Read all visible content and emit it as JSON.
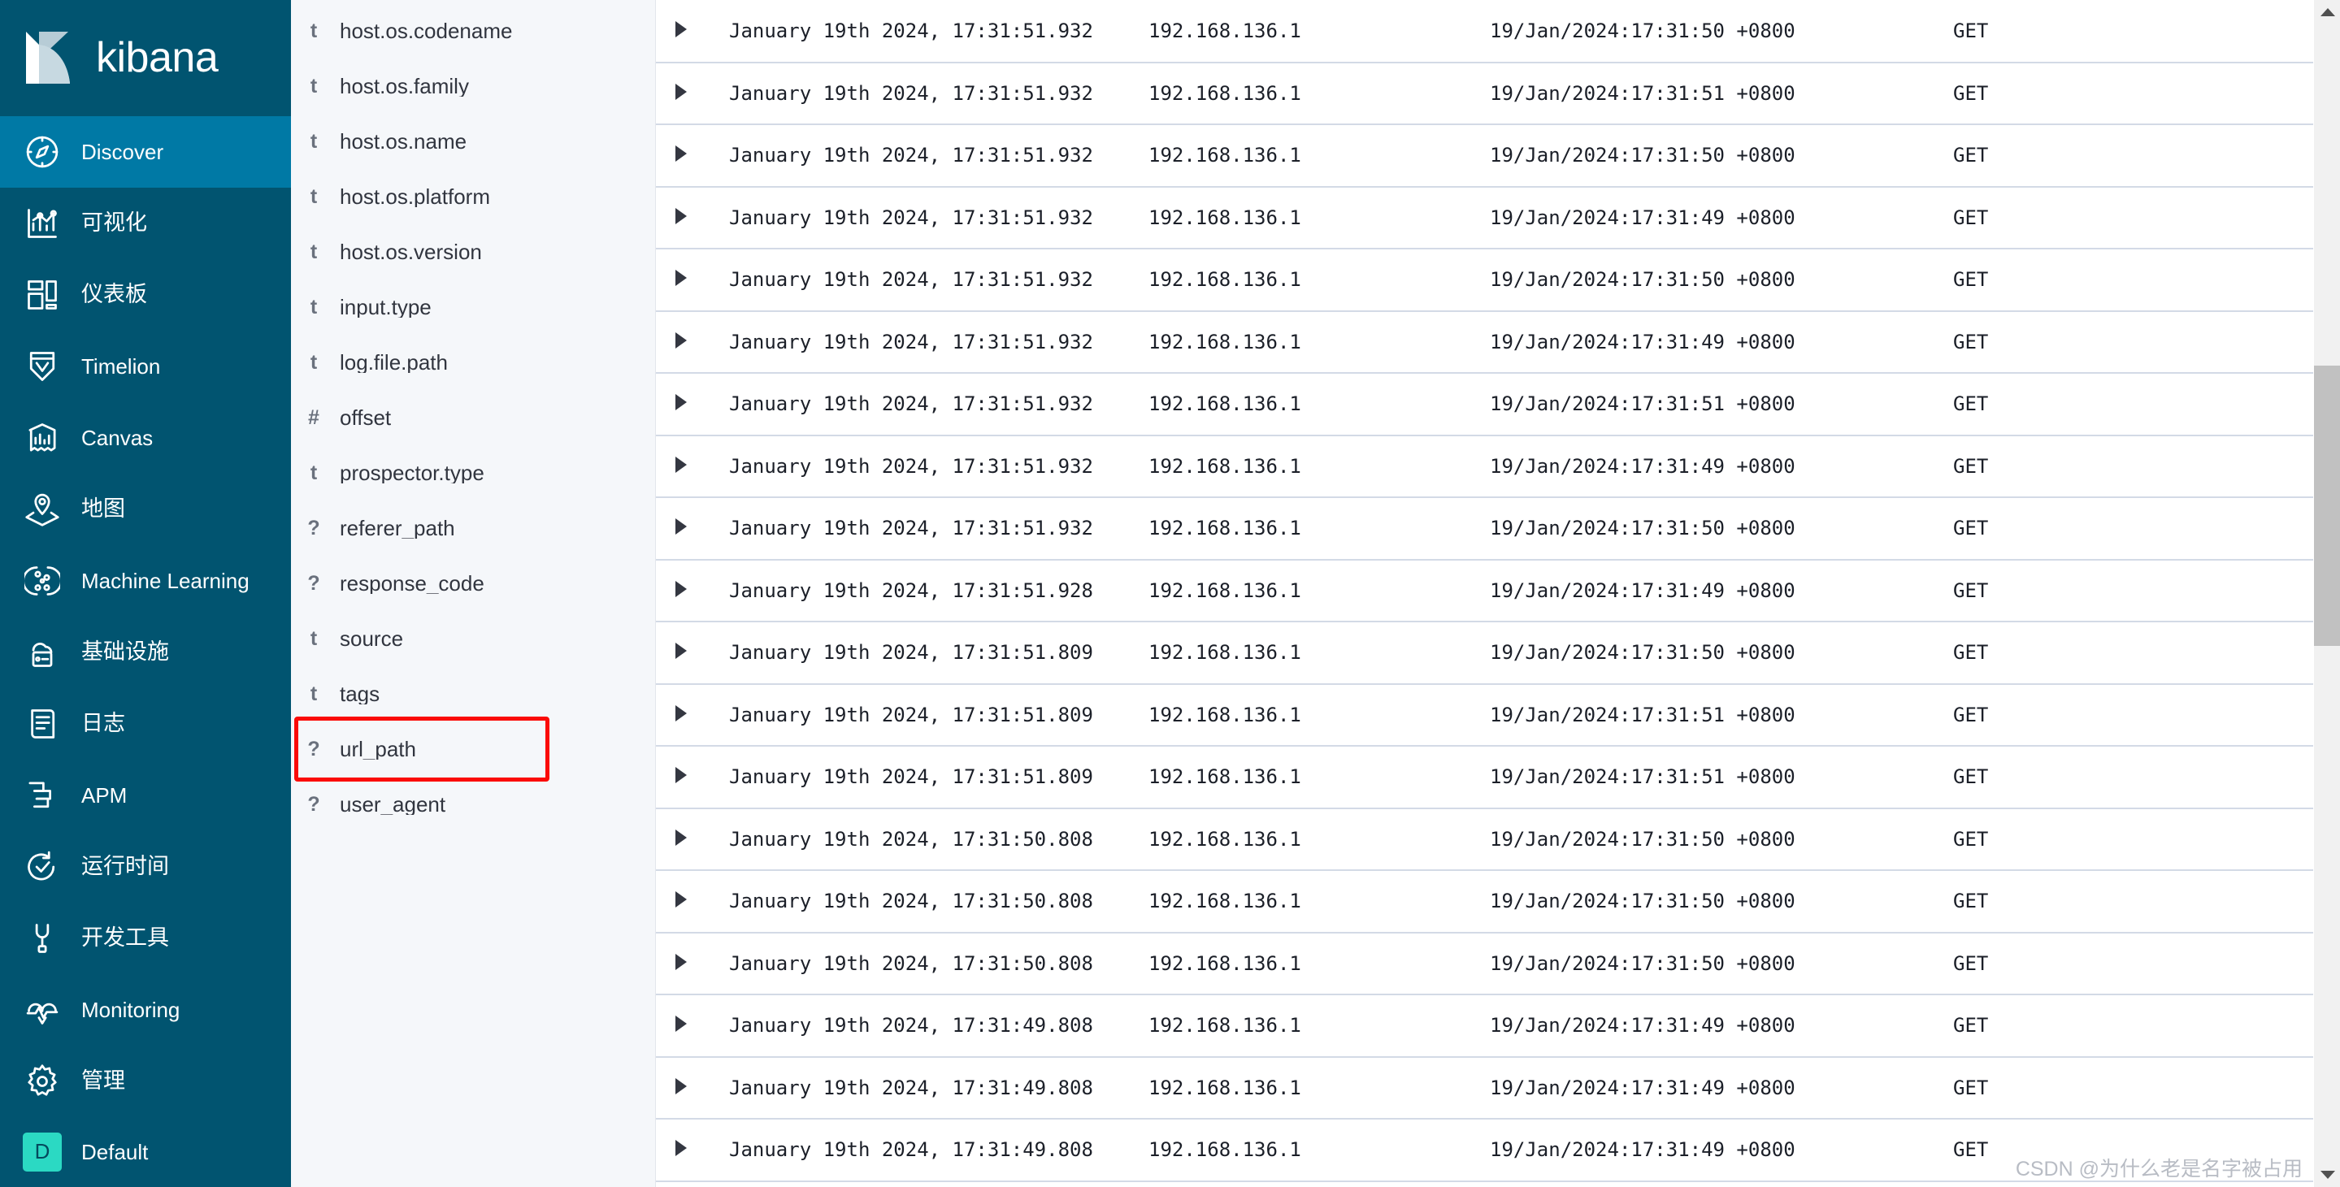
{
  "app": {
    "brand_name": "kibana",
    "logo_icon": "kibana-logo-icon"
  },
  "sidebar": {
    "items": [
      {
        "label": "Discover",
        "icon": "compass-icon",
        "active": true,
        "cjk": false
      },
      {
        "label": "可视化",
        "icon": "visualize-icon",
        "active": false,
        "cjk": true
      },
      {
        "label": "仪表板",
        "icon": "dashboard-icon",
        "active": false,
        "cjk": true
      },
      {
        "label": "Timelion",
        "icon": "timelion-icon",
        "active": false,
        "cjk": false
      },
      {
        "label": "Canvas",
        "icon": "canvas-icon",
        "active": false,
        "cjk": false
      },
      {
        "label": "地图",
        "icon": "maps-icon",
        "active": false,
        "cjk": true
      },
      {
        "label": "Machine Learning",
        "icon": "machine-learning-icon",
        "active": false,
        "cjk": false
      },
      {
        "label": "基础设施",
        "icon": "infrastructure-icon",
        "active": false,
        "cjk": true
      },
      {
        "label": "日志",
        "icon": "logs-icon",
        "active": false,
        "cjk": true
      },
      {
        "label": "APM",
        "icon": "apm-icon",
        "active": false,
        "cjk": false
      },
      {
        "label": "运行时间",
        "icon": "uptime-icon",
        "active": false,
        "cjk": true
      },
      {
        "label": "开发工具",
        "icon": "dev-tools-icon",
        "active": false,
        "cjk": true
      },
      {
        "label": "Monitoring",
        "icon": "monitoring-icon",
        "active": false,
        "cjk": false
      },
      {
        "label": "管理",
        "icon": "management-icon",
        "active": false,
        "cjk": true
      }
    ],
    "user": {
      "initial": "D",
      "label": "Default"
    }
  },
  "field_panel": {
    "fields": [
      {
        "type": "t",
        "name": "host.os.codename",
        "highlight": false
      },
      {
        "type": "t",
        "name": "host.os.family",
        "highlight": false
      },
      {
        "type": "t",
        "name": "host.os.name",
        "highlight": false
      },
      {
        "type": "t",
        "name": "host.os.platform",
        "highlight": false
      },
      {
        "type": "t",
        "name": "host.os.version",
        "highlight": false
      },
      {
        "type": "t",
        "name": "input.type",
        "highlight": false
      },
      {
        "type": "t",
        "name": "log.file.path",
        "highlight": false
      },
      {
        "type": "#",
        "name": "offset",
        "highlight": false
      },
      {
        "type": "t",
        "name": "prospector.type",
        "highlight": false
      },
      {
        "type": "?",
        "name": "referer_path",
        "highlight": false
      },
      {
        "type": "?",
        "name": "response_code",
        "highlight": false
      },
      {
        "type": "t",
        "name": "source",
        "highlight": false
      },
      {
        "type": "t",
        "name": "tags",
        "highlight": false
      },
      {
        "type": "?",
        "name": "url_path",
        "highlight": true
      },
      {
        "type": "?",
        "name": "user_agent",
        "highlight": false
      }
    ]
  },
  "main": {
    "expand_icon": "expand-row-caret-icon",
    "rows": [
      {
        "time": "January 19th 2024, 17:31:51.932",
        "ip": "192.168.136.1",
        "ts": "19/Jan/2024:17:31:50 +0800",
        "method": "GET"
      },
      {
        "time": "January 19th 2024, 17:31:51.932",
        "ip": "192.168.136.1",
        "ts": "19/Jan/2024:17:31:51 +0800",
        "method": "GET"
      },
      {
        "time": "January 19th 2024, 17:31:51.932",
        "ip": "192.168.136.1",
        "ts": "19/Jan/2024:17:31:50 +0800",
        "method": "GET"
      },
      {
        "time": "January 19th 2024, 17:31:51.932",
        "ip": "192.168.136.1",
        "ts": "19/Jan/2024:17:31:49 +0800",
        "method": "GET"
      },
      {
        "time": "January 19th 2024, 17:31:51.932",
        "ip": "192.168.136.1",
        "ts": "19/Jan/2024:17:31:50 +0800",
        "method": "GET"
      },
      {
        "time": "January 19th 2024, 17:31:51.932",
        "ip": "192.168.136.1",
        "ts": "19/Jan/2024:17:31:49 +0800",
        "method": "GET"
      },
      {
        "time": "January 19th 2024, 17:31:51.932",
        "ip": "192.168.136.1",
        "ts": "19/Jan/2024:17:31:51 +0800",
        "method": "GET"
      },
      {
        "time": "January 19th 2024, 17:31:51.932",
        "ip": "192.168.136.1",
        "ts": "19/Jan/2024:17:31:49 +0800",
        "method": "GET"
      },
      {
        "time": "January 19th 2024, 17:31:51.932",
        "ip": "192.168.136.1",
        "ts": "19/Jan/2024:17:31:50 +0800",
        "method": "GET"
      },
      {
        "time": "January 19th 2024, 17:31:51.928",
        "ip": "192.168.136.1",
        "ts": "19/Jan/2024:17:31:49 +0800",
        "method": "GET"
      },
      {
        "time": "January 19th 2024, 17:31:51.809",
        "ip": "192.168.136.1",
        "ts": "19/Jan/2024:17:31:50 +0800",
        "method": "GET"
      },
      {
        "time": "January 19th 2024, 17:31:51.809",
        "ip": "192.168.136.1",
        "ts": "19/Jan/2024:17:31:51 +0800",
        "method": "GET"
      },
      {
        "time": "January 19th 2024, 17:31:51.809",
        "ip": "192.168.136.1",
        "ts": "19/Jan/2024:17:31:51 +0800",
        "method": "GET"
      },
      {
        "time": "January 19th 2024, 17:31:50.808",
        "ip": "192.168.136.1",
        "ts": "19/Jan/2024:17:31:50 +0800",
        "method": "GET"
      },
      {
        "time": "January 19th 2024, 17:31:50.808",
        "ip": "192.168.136.1",
        "ts": "19/Jan/2024:17:31:50 +0800",
        "method": "GET"
      },
      {
        "time": "January 19th 2024, 17:31:50.808",
        "ip": "192.168.136.1",
        "ts": "19/Jan/2024:17:31:50 +0800",
        "method": "GET"
      },
      {
        "time": "January 19th 2024, 17:31:49.808",
        "ip": "192.168.136.1",
        "ts": "19/Jan/2024:17:31:49 +0800",
        "method": "GET"
      },
      {
        "time": "January 19th 2024, 17:31:49.808",
        "ip": "192.168.136.1",
        "ts": "19/Jan/2024:17:31:49 +0800",
        "method": "GET"
      },
      {
        "time": "January 19th 2024, 17:31:49.808",
        "ip": "192.168.136.1",
        "ts": "19/Jan/2024:17:31:49 +0800",
        "method": "GET"
      }
    ]
  },
  "scrollbar": {
    "up_icon": "scroll-up-arrow-icon",
    "down_icon": "scroll-down-arrow-icon"
  },
  "watermark": {
    "text": "CSDN @为什么老是名字被占用"
  },
  "colors": {
    "sidebar_bg": "#015470",
    "sidebar_active": "#0079a5",
    "avatar_bg": "#2bd9c3",
    "field_panel_bg": "#f5f7fa",
    "highlight_border": "#fb0b07",
    "row_border": "#d3dae6"
  }
}
